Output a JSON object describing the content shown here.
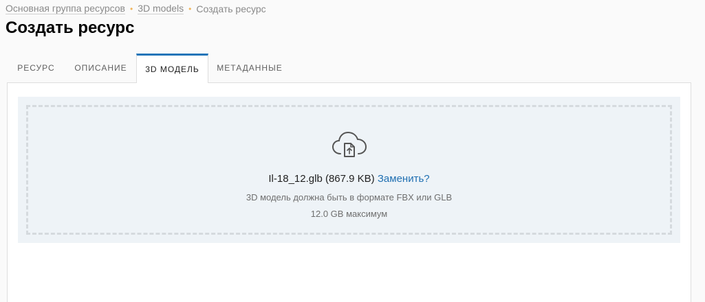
{
  "breadcrumb": {
    "items": [
      "Основная группа ресурсов",
      "3D models",
      "Создать ресурс"
    ],
    "separator": "•"
  },
  "page": {
    "title": "Создать ресурс"
  },
  "tabs": [
    {
      "label": "РЕСУРС",
      "active": false
    },
    {
      "label": "ОПИСАНИЕ",
      "active": false
    },
    {
      "label": "3D МОДЕЛЬ",
      "active": true
    },
    {
      "label": "МЕТАДАННЫЕ",
      "active": false
    }
  ],
  "upload": {
    "icon": "cloud-upload-file-icon",
    "file_name": "Il-18_12.glb",
    "file_size": "(867.9 KB)",
    "replace_label": "Заменить?",
    "format_hint": "3D модель должна быть в формате FBX или GLB",
    "size_limit": "12.0 GB максимум"
  },
  "colors": {
    "accent": "#1f75b9",
    "link": "#1f6fb2",
    "breadcrumb_separator": "#f0b45a",
    "dropzone_bg": "#eef3f7"
  }
}
